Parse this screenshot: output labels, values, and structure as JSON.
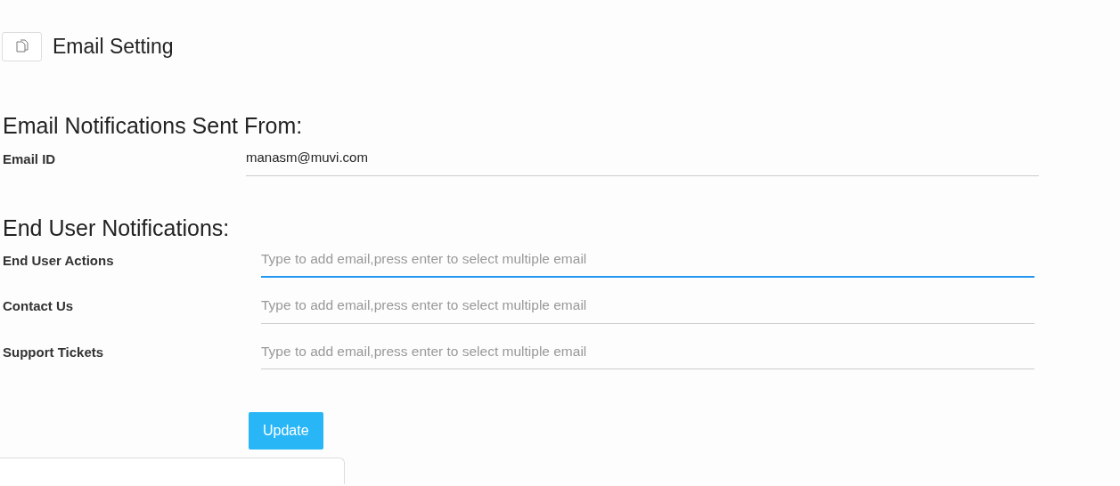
{
  "header": {
    "title": "Email Setting"
  },
  "sender": {
    "heading": "Email Notifications Sent From:",
    "label": "Email ID",
    "value": "manasm@muvi.com"
  },
  "notifications": {
    "heading": "End User Notifications:",
    "fields": [
      {
        "label": "End User Actions",
        "placeholder": "Type to add email,press enter to select multiple email",
        "focused": true
      },
      {
        "label": "Contact Us",
        "placeholder": "Type to add email,press enter to select multiple email",
        "focused": false
      },
      {
        "label": "Support Tickets",
        "placeholder": "Type to add email,press enter to select multiple email",
        "focused": false
      }
    ]
  },
  "update_button": "Update"
}
